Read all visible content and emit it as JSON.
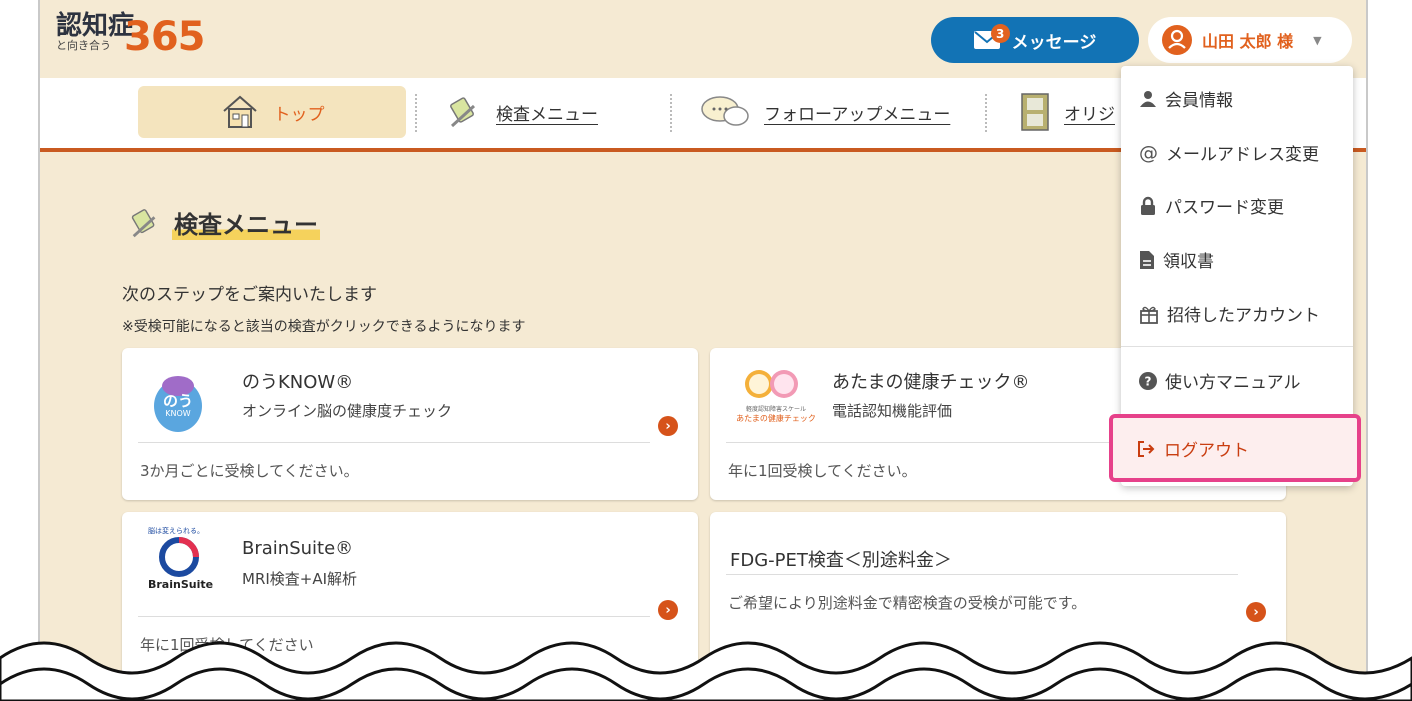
{
  "header": {
    "logo_title": "認知症",
    "logo_number": "365",
    "logo_subtitle": "と向き合う",
    "message_label": "メッセージ",
    "message_count": "3",
    "user_name": "山田 太郎 様"
  },
  "nav": {
    "items": [
      {
        "label": "トップ",
        "icon": "house-icon"
      },
      {
        "label": "検査メニュー",
        "icon": "pencil-book-icon"
      },
      {
        "label": "フォローアップメニュー",
        "icon": "speech-bubble-icon"
      },
      {
        "label": "オリジ",
        "icon": "film-icon"
      }
    ]
  },
  "section": {
    "title": "検査メニュー",
    "intro": "次のステップをご案内いたします",
    "note": "※受検可能になると該当の検査がクリックできるようになります"
  },
  "cards": [
    {
      "name": "のうKNOW®",
      "desc": "オンライン脳の健康度チェック",
      "note": "3か月ごとに受検してください。",
      "logo_text": "のう",
      "logo_sub": "KNOW"
    },
    {
      "name": "あたまの健康チェック®",
      "desc": "電話認知機能評価",
      "note": "年に1回受検してください。",
      "logo_text": "あたまの健康チェック",
      "logo_sub": "軽度認知障害スケール"
    },
    {
      "name": "BrainSuite®",
      "desc": "MRI検査+AI解析",
      "note": "年に1回受検してください",
      "logo_text": "BrainSuite",
      "logo_sub": "脳は変えられる。"
    },
    {
      "name": "FDG-PET検査＜別途料金＞",
      "desc": "",
      "note": "ご希望により別途料金で精密検査の受検が可能です。"
    }
  ],
  "dropdown": {
    "items": [
      {
        "label": "会員情報",
        "icon": "person-icon"
      },
      {
        "label": "メールアドレス変更",
        "icon": "at-icon"
      },
      {
        "label": "パスワード変更",
        "icon": "lock-icon"
      },
      {
        "label": "領収書",
        "icon": "document-icon"
      },
      {
        "label": "招待したアカウント",
        "icon": "gift-icon"
      },
      {
        "label": "使い方マニュアル",
        "icon": "help-icon"
      },
      {
        "label": "ログアウト",
        "icon": "logout-icon"
      }
    ]
  },
  "colors": {
    "accent": "#e1611e",
    "primary": "#1273b5",
    "background": "#f5ead3",
    "highlight": "#e6418a"
  }
}
